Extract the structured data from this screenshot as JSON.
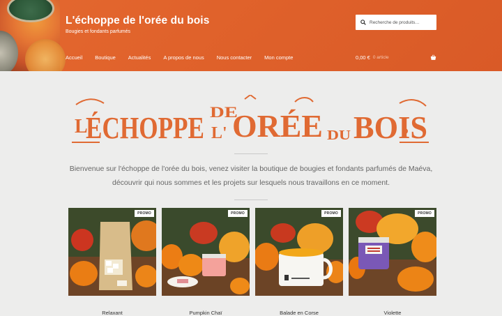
{
  "site": {
    "title": "L'échoppe de l'orée du bois",
    "tagline": "Bougies et fondants parfumés"
  },
  "search": {
    "placeholder": "Recherche de produits…"
  },
  "nav": {
    "items": [
      {
        "label": "Accueil"
      },
      {
        "label": "Boutique"
      },
      {
        "label": "Actualités"
      },
      {
        "label": "A propos de nous"
      },
      {
        "label": "Nous contacter"
      },
      {
        "label": "Mon compte"
      }
    ]
  },
  "cart": {
    "total": "0,00 €",
    "count": "0 article"
  },
  "logo": {
    "words": [
      "L'",
      "ÉCHOPPE",
      "DE",
      "L'",
      "ORÉE",
      "DU",
      "BOIS"
    ],
    "color": "#e06a33"
  },
  "intro": {
    "line1": "Bienvenue sur l'échoppe de l'orée du bois, venez visiter la boutique de bougies et fondants parfumés de Maéva,",
    "line2": "découvrir qui nous sommes et les projets sur lesquels nous travaillons en ce moment."
  },
  "products": [
    {
      "name": "Relaxant",
      "badge": "PROMO"
    },
    {
      "name": "Pumpkin Chaï",
      "badge": "PROMO"
    },
    {
      "name": "Balade en Corse",
      "badge": "PROMO"
    },
    {
      "name": "Violette",
      "badge": "PROMO"
    }
  ],
  "colors": {
    "header": "#e0622b",
    "background": "#ededec",
    "accent": "#e06a33"
  }
}
